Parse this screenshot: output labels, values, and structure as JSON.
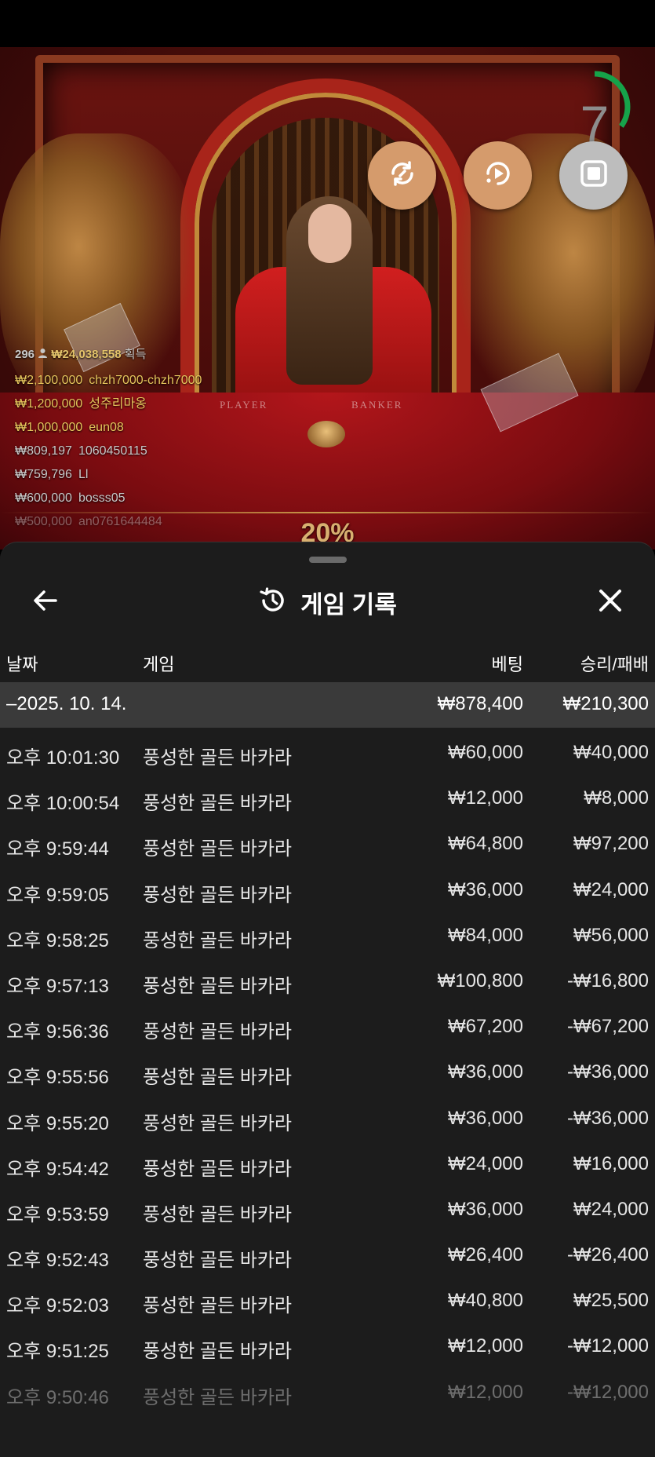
{
  "live_view": {
    "winners_summary": {
      "count": "296",
      "total": "₩24,038,558",
      "suffix": "획득"
    },
    "winners": [
      {
        "amount": "₩2,100,000",
        "name": "chzh7000-chzh7000",
        "tier": "gold"
      },
      {
        "amount": "₩1,200,000",
        "name": "성주리마옹",
        "tier": "gold"
      },
      {
        "amount": "₩1,000,000",
        "name": "eun08",
        "tier": "gold"
      },
      {
        "amount": "₩809,197",
        "name": "1060450115",
        "tier": "grey"
      },
      {
        "amount": "₩759,796",
        "name": "Ll",
        "tier": "grey"
      },
      {
        "amount": "₩600,000",
        "name": "bosss05",
        "tier": "grey"
      },
      {
        "amount": "₩500,000",
        "name": "an0761644484",
        "tier": "grey"
      }
    ],
    "table_labels": {
      "player": "PLAYER",
      "banker": "BANKER"
    },
    "percent": "20%",
    "countdown": "7",
    "countdown_fraction": 0.35,
    "icons": {
      "swap": "swap-icon",
      "replay": "replay-icon",
      "stop": "stop-icon"
    }
  },
  "sheet": {
    "title": "게임 기록",
    "icons": {
      "back": "arrow-left-icon",
      "history": "history-icon",
      "close": "close-icon"
    },
    "columns": {
      "date": "날짜",
      "game": "게임",
      "bet": "베팅",
      "result": "승리/패배"
    },
    "group": {
      "date": "–2025. 10. 14.",
      "bet": "₩878,400",
      "result": "₩210,300"
    },
    "rows": [
      {
        "time": "오후 10:01:30",
        "game": "풍성한 골든 바카라",
        "bet": "₩60,000",
        "result": "₩40,000"
      },
      {
        "time": "오후 10:00:54",
        "game": "풍성한 골든 바카라",
        "bet": "₩12,000",
        "result": "₩8,000"
      },
      {
        "time": "오후 9:59:44",
        "game": "풍성한 골든 바카라",
        "bet": "₩64,800",
        "result": "₩97,200"
      },
      {
        "time": "오후 9:59:05",
        "game": "풍성한 골든 바카라",
        "bet": "₩36,000",
        "result": "₩24,000"
      },
      {
        "time": "오후 9:58:25",
        "game": "풍성한 골든 바카라",
        "bet": "₩84,000",
        "result": "₩56,000"
      },
      {
        "time": "오후 9:57:13",
        "game": "풍성한 골든 바카라",
        "bet": "₩100,800",
        "result": "-₩16,800"
      },
      {
        "time": "오후 9:56:36",
        "game": "풍성한 골든 바카라",
        "bet": "₩67,200",
        "result": "-₩67,200"
      },
      {
        "time": "오후 9:55:56",
        "game": "풍성한 골든 바카라",
        "bet": "₩36,000",
        "result": "-₩36,000"
      },
      {
        "time": "오후 9:55:20",
        "game": "풍성한 골든 바카라",
        "bet": "₩36,000",
        "result": "-₩36,000"
      },
      {
        "time": "오후 9:54:42",
        "game": "풍성한 골든 바카라",
        "bet": "₩24,000",
        "result": "₩16,000"
      },
      {
        "time": "오후 9:53:59",
        "game": "풍성한 골든 바카라",
        "bet": "₩36,000",
        "result": "₩24,000"
      },
      {
        "time": "오후 9:52:43",
        "game": "풍성한 골든 바카라",
        "bet": "₩26,400",
        "result": "-₩26,400"
      },
      {
        "time": "오후 9:52:03",
        "game": "풍성한 골든 바카라",
        "bet": "₩40,800",
        "result": "₩25,500"
      },
      {
        "time": "오후 9:51:25",
        "game": "풍성한 골든 바카라",
        "bet": "₩12,000",
        "result": "-₩12,000"
      },
      {
        "time": "오후 9:50:46",
        "game": "풍성한 골든 바카라",
        "bet": "₩12,000",
        "result": "-₩12,000"
      }
    ]
  }
}
